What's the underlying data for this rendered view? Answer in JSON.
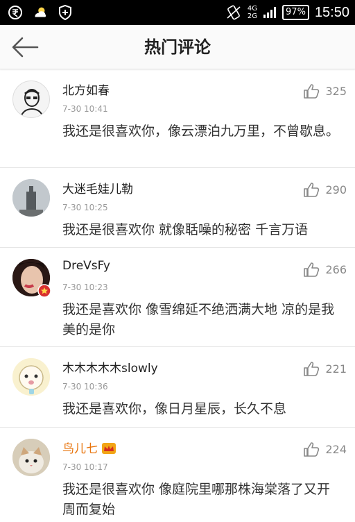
{
  "status_bar": {
    "icons": [
      "rupee-icon",
      "weather-icon",
      "shield-icon"
    ],
    "network_top": "4G",
    "network_bottom": "2G",
    "battery": "97%",
    "time": "15:50"
  },
  "header": {
    "back_icon": "arrow-left-icon",
    "title": "热门评论"
  },
  "comments": [
    {
      "user": "北方如春",
      "time": "7-30 10:41",
      "likes": "325",
      "text": "我还是很喜欢你，像云漂泊九万里，不曾歇息。"
    },
    {
      "user": "大迷毛娃儿勒",
      "time": "7-30 10:25",
      "likes": "290",
      "text": "我还是很喜欢你 就像聒噪的秘密 千言万语"
    },
    {
      "user": "DreVsFy",
      "time": "7-30 10:23",
      "likes": "266",
      "text": "我还是喜欢你 像雪绵延不绝洒满大地 凉的是我 美的是你"
    },
    {
      "user": "木木木木木slowly",
      "time": "7-30 10:36",
      "likes": "221",
      "text": "我还是喜欢你，像日月星辰，长久不息"
    },
    {
      "user": "鸟儿七",
      "time": "7-30 10:17",
      "likes": "224",
      "text": "我还是很喜欢你 像庭院里哪那株海棠落了又开 周而复始"
    }
  ],
  "colors": {
    "vip_name": "#e8740c",
    "text": "#333333",
    "meta": "#999999",
    "status_bar": "#000000"
  }
}
